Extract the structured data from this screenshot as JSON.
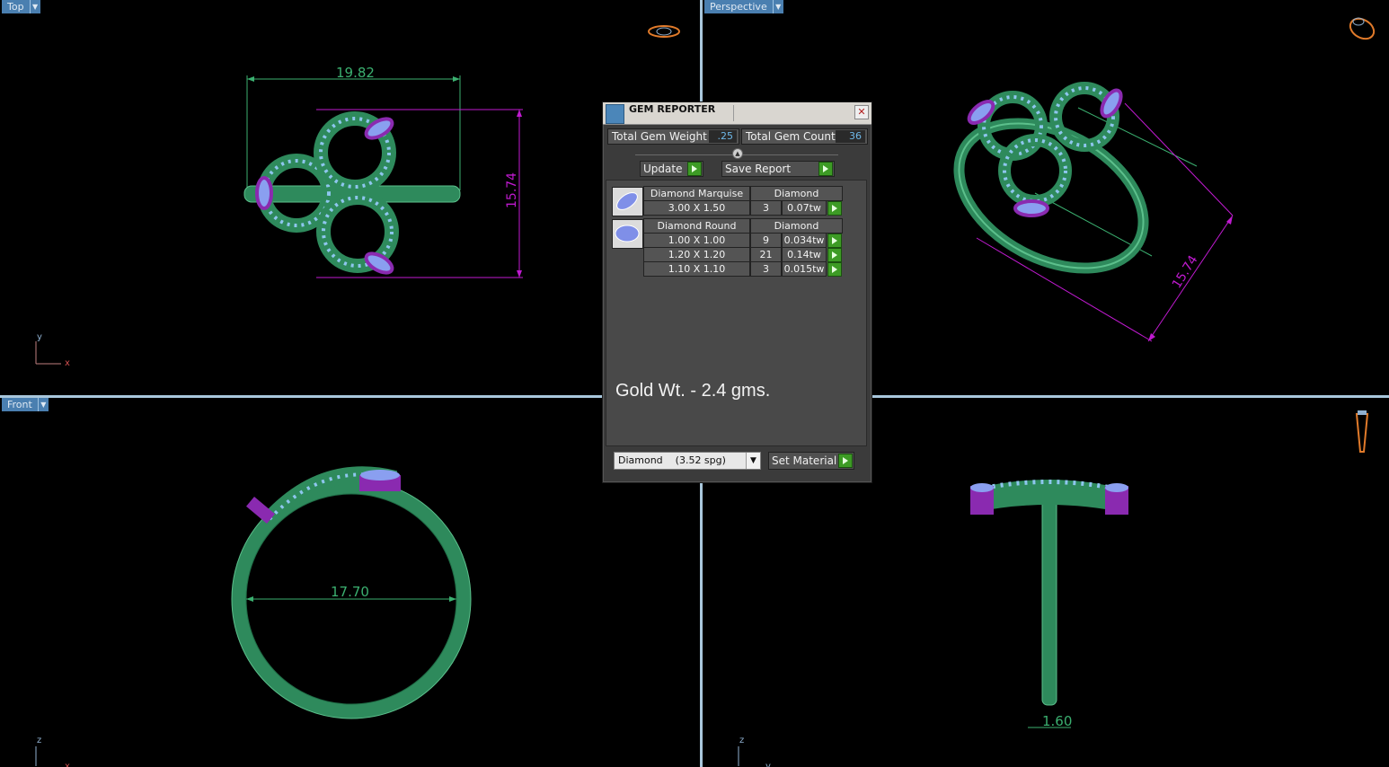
{
  "viewports": {
    "top": {
      "label": "Top",
      "dim_width": "19.82",
      "dim_height": "15.74",
      "axis_v": "y",
      "axis_h": "x"
    },
    "perspective": {
      "label": "Perspective",
      "dim_length": "15.74"
    },
    "front": {
      "label": "Front",
      "dim_diameter": "17.70",
      "axis_v": "z",
      "axis_h": "x"
    },
    "right": {
      "label": "",
      "dim_band": "1.60",
      "axis_v": "z",
      "axis_h": "y"
    }
  },
  "gem_reporter": {
    "title": "GEM REPORTER",
    "close_glyph": "✕",
    "total_weight_label": "Total Gem Weight",
    "total_weight_value": ".25",
    "total_count_label": "Total Gem Count",
    "total_count_value": "36",
    "update_label": "Update",
    "save_report_label": "Save Report",
    "groups": [
      {
        "shape": "Diamond Marquise",
        "material": "Diamond",
        "icon": "marquise-gem-icon",
        "rows": [
          {
            "size": "3.00 X 1.50",
            "count": "3",
            "weight": "0.07tw"
          }
        ]
      },
      {
        "shape": "Diamond Round",
        "material": "Diamond",
        "icon": "round-gem-icon",
        "rows": [
          {
            "size": "1.00 X 1.00",
            "count": "9",
            "weight": "0.034tw"
          },
          {
            "size": "1.20 X 1.20",
            "count": "21",
            "weight": "0.14tw"
          },
          {
            "size": "1.10 X 1.10",
            "count": "3",
            "weight": "0.015tw"
          }
        ]
      }
    ],
    "note": "Gold Wt. - 2.4 gms.",
    "material_select": "Diamond    (3.52 spg)",
    "set_material_label": "Set Material"
  },
  "colors": {
    "metal": "#2e8a5c",
    "setting": "#8a2ab0",
    "gem": "#a6c8f0",
    "dimension_green": "#3bb070",
    "dimension_magenta": "#c01ad0",
    "divider": "#a9c7dc"
  }
}
